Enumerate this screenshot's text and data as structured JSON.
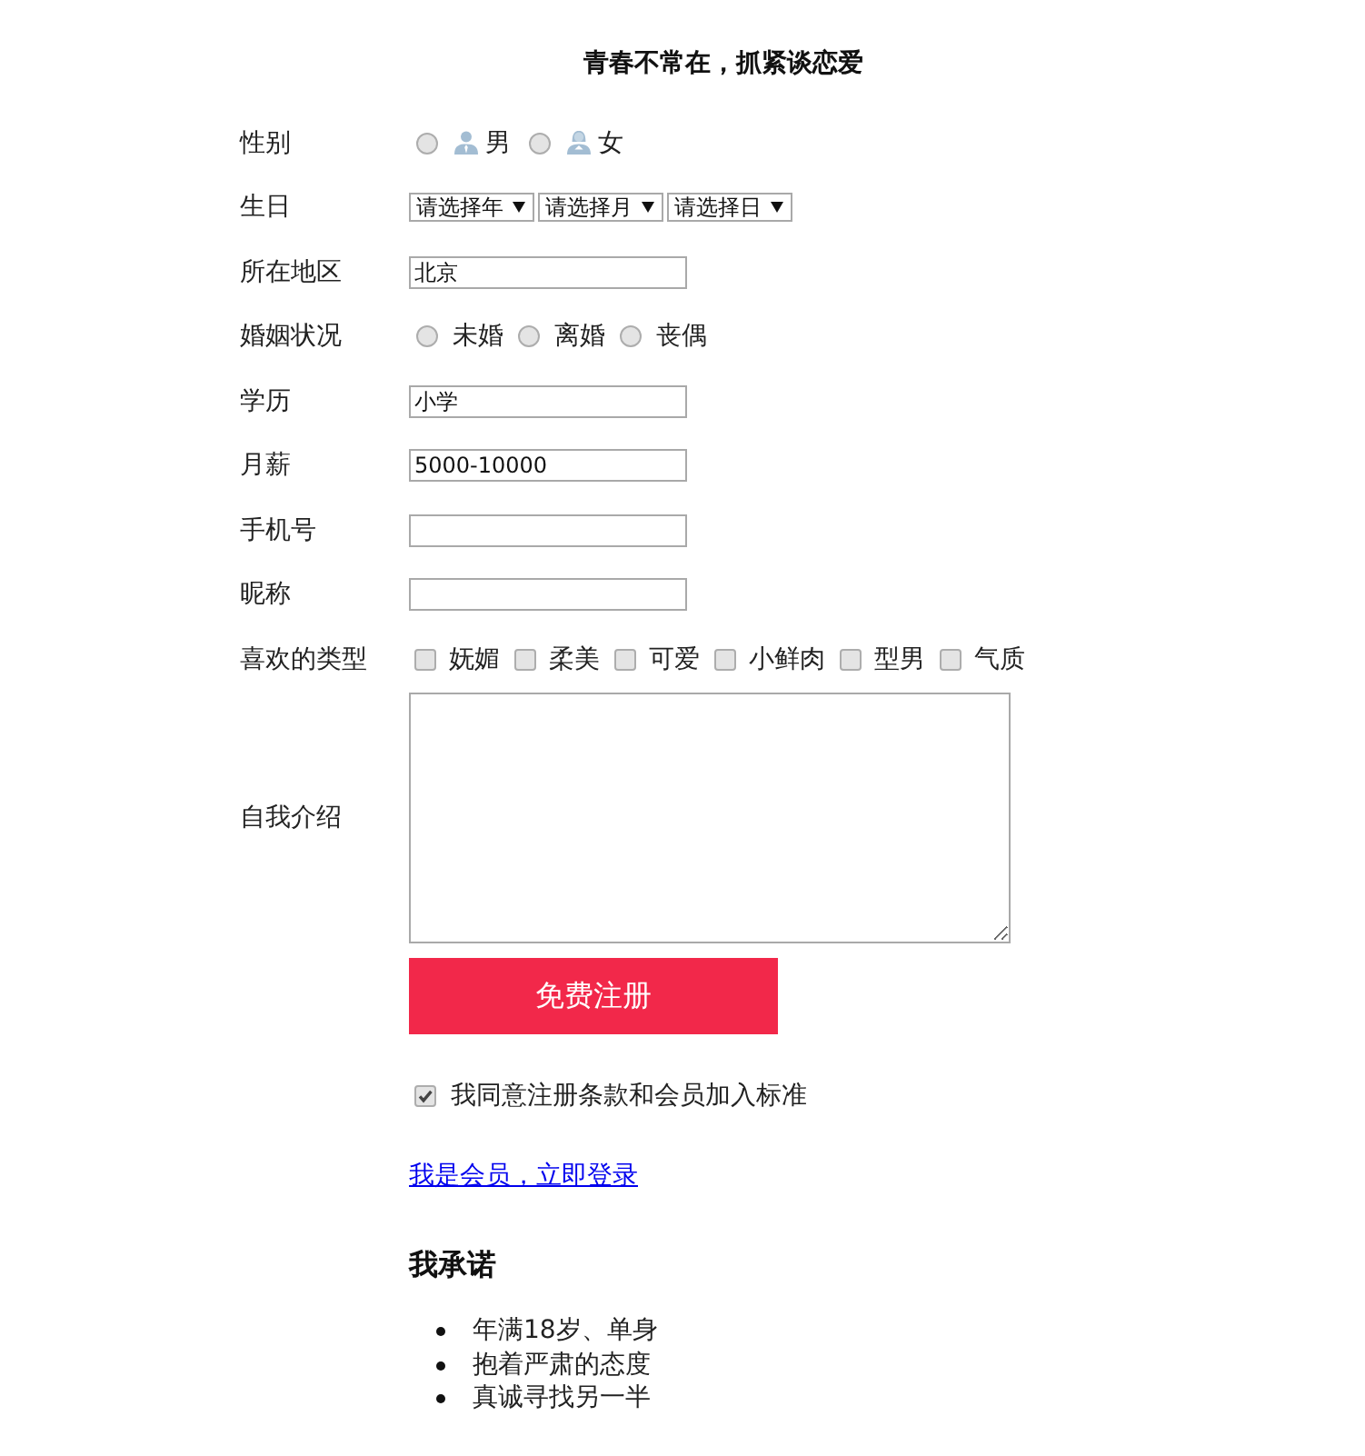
{
  "title": "青春不常在，抓紧谈恋爱",
  "fields": [
    {
      "kind": "radio_icons",
      "label": "性别",
      "options": [
        {
          "label": "男",
          "selected": false
        },
        {
          "label": "女",
          "selected": false
        }
      ]
    },
    {
      "kind": "selects",
      "label": "生日",
      "selects": [
        "请选择年",
        "请选择月",
        "请选择日"
      ]
    },
    {
      "kind": "text",
      "label": "所在地区",
      "value": "北京"
    },
    {
      "kind": "radio",
      "label": "婚姻状况",
      "options": [
        {
          "label": "未婚",
          "selected": false
        },
        {
          "label": "离婚",
          "selected": false
        },
        {
          "label": "丧偶",
          "selected": false
        }
      ]
    },
    {
      "kind": "text",
      "label": "学历",
      "value": "小学"
    },
    {
      "kind": "text",
      "label": "月薪",
      "value": "5000-10000"
    },
    {
      "kind": "text",
      "label": "手机号"
    },
    {
      "kind": "text",
      "label": "昵称"
    },
    {
      "kind": "checkbox",
      "label": "喜欢的类型",
      "options": [
        {
          "label": "妩媚",
          "checked": false
        },
        {
          "label": "柔美",
          "checked": false
        },
        {
          "label": "可爱",
          "checked": false
        },
        {
          "label": "小鲜肉",
          "checked": false
        },
        {
          "label": "型男",
          "checked": false
        },
        {
          "label": "气质",
          "checked": false
        }
      ]
    },
    {
      "kind": "textarea",
      "label": "自我介绍"
    }
  ],
  "submit_button": "免费注册",
  "agreement": {
    "label": "我同意注册条款和会员加入标准",
    "checked": true
  },
  "login_link": "我是会员，立即登录",
  "pledge": {
    "title": "我承诺",
    "items": [
      "年满18岁、单身",
      "抱着严肃的态度",
      "真诚寻找另一半"
    ]
  }
}
